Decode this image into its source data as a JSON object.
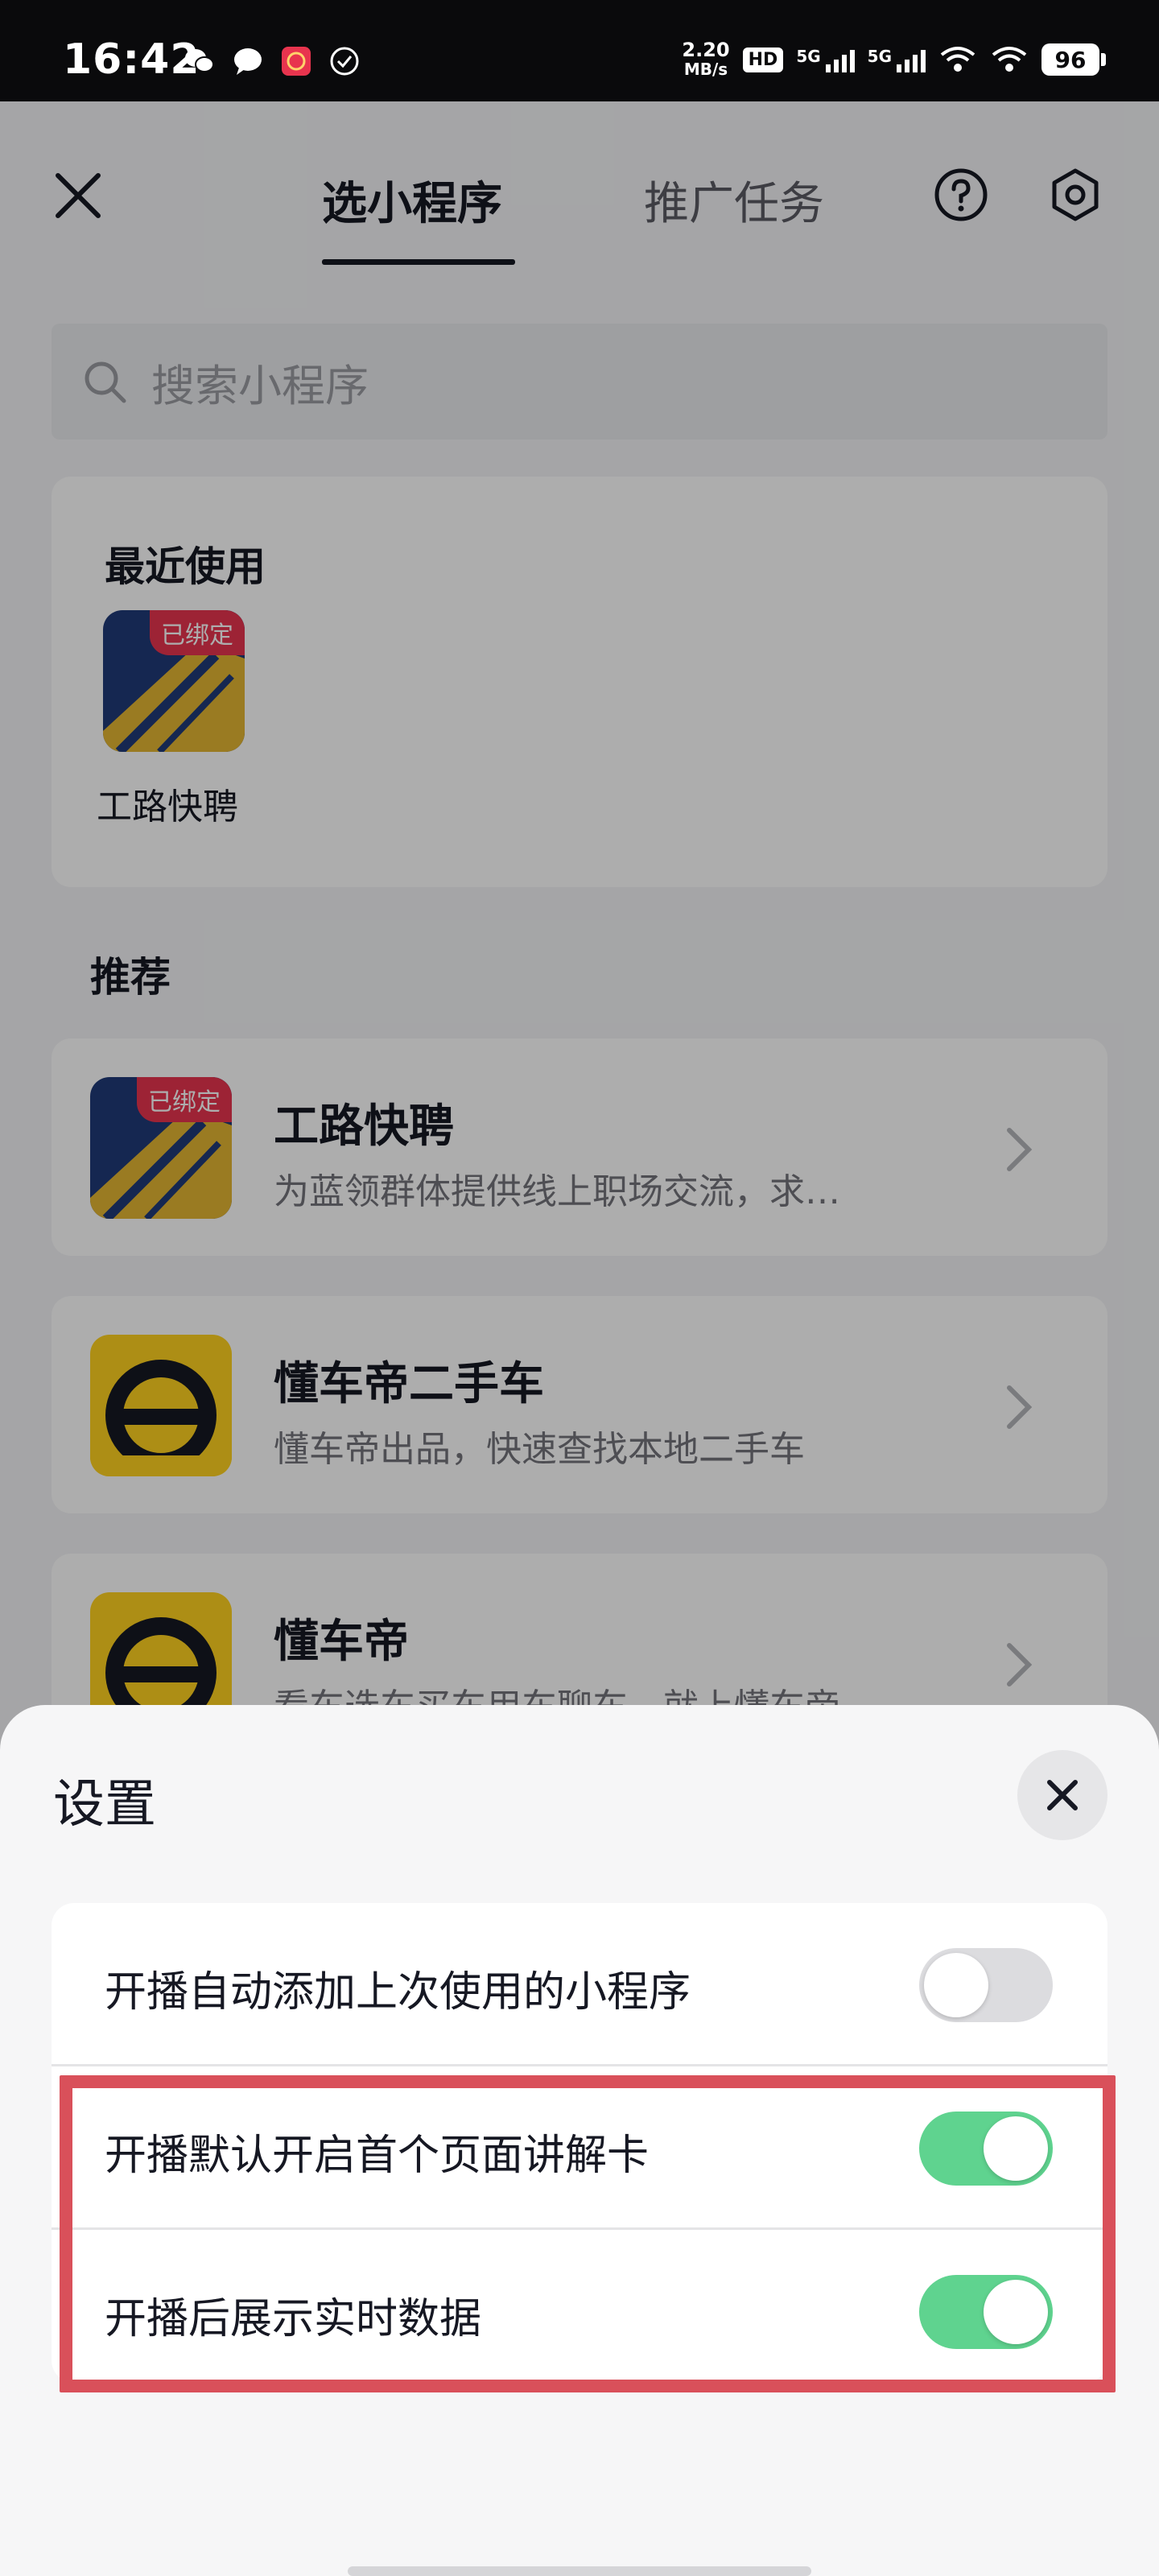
{
  "status_bar": {
    "time": "16:42",
    "net_speed_value": "2.20",
    "net_speed_unit": "MB/s",
    "hd": "HD",
    "sim1": "5G",
    "sim2": "5G",
    "battery": "96",
    "icons": [
      "wechat-icon",
      "message-icon",
      "red-app-icon",
      "check-circle-icon",
      "wifi-calling-icon",
      "wifi-icon"
    ]
  },
  "nav": {
    "tab_active": "选小程序",
    "tab_inactive": "推广任务",
    "icons": [
      "close-icon",
      "help-icon",
      "hexagon-settings-icon"
    ]
  },
  "search": {
    "placeholder": "搜索小程序"
  },
  "recent": {
    "title": "最近使用",
    "apps": [
      {
        "name": "工路快聘",
        "badge": "已绑定"
      }
    ]
  },
  "recommend": {
    "title": "推荐",
    "items": [
      {
        "name": "工路快聘",
        "desc": "为蓝领群体提供线上职场交流，求…",
        "badge": "已绑定"
      },
      {
        "name": "懂车帝二手车",
        "desc": "懂车帝出品，快速查找本地二手车"
      },
      {
        "name": "懂车帝",
        "desc": "看车选车买车用车聊车，就上懂车帝"
      }
    ]
  },
  "sheet": {
    "title": "设置",
    "settings": [
      {
        "label": "开播自动添加上次使用的小程序",
        "enabled": false
      },
      {
        "label": "开播默认开启首个页面讲解卡",
        "enabled": true
      },
      {
        "label": "开播后展示实时数据",
        "enabled": true
      }
    ]
  },
  "colors": {
    "toggle_on": "#5fd38f",
    "toggle_off": "#dcdcdf",
    "badge": "#e8344e",
    "highlight_box": "#d9505a"
  }
}
